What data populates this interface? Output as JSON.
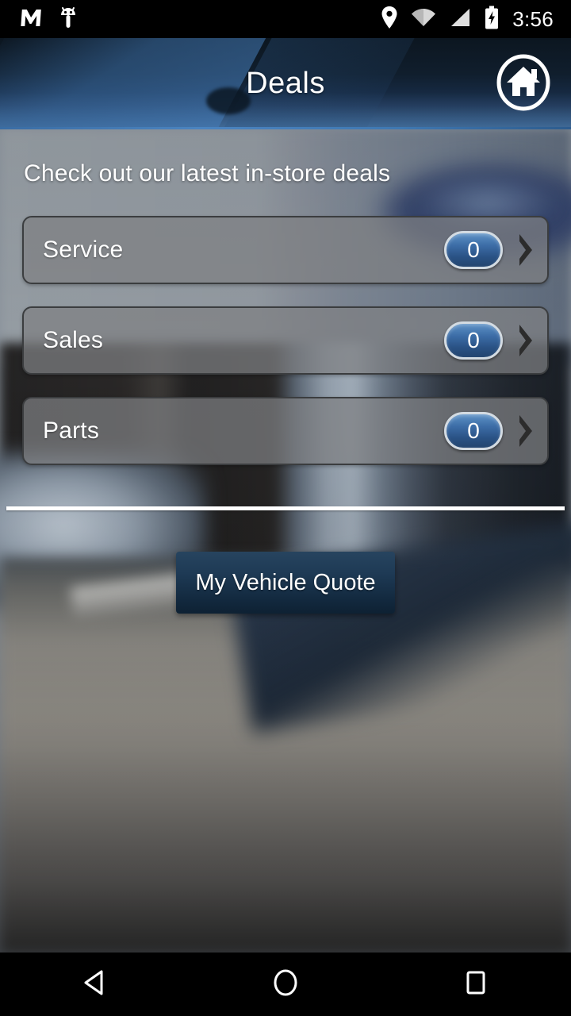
{
  "status_bar": {
    "icons": [
      "gmail-m-icon",
      "android-debug-icon",
      "location-pin-icon",
      "wifi-icon",
      "cellular-signal-icon",
      "battery-charging-icon"
    ],
    "time": "3:56"
  },
  "header": {
    "title": "Deals",
    "home_icon": "home-icon",
    "accent_color": "#3f78b2",
    "background_color": "#101e2d"
  },
  "main": {
    "subtitle": "Check out our latest in-store deals",
    "deals": [
      {
        "label": "Service",
        "count": "0",
        "chevron": "chevron-right-icon"
      },
      {
        "label": "Sales",
        "count": "0",
        "chevron": "chevron-right-icon"
      },
      {
        "label": "Parts",
        "count": "0",
        "chevron": "chevron-right-icon"
      }
    ],
    "badge_color": "#3d6ea8",
    "quote_button": {
      "label": "My Vehicle Quote",
      "color": "#1e3a55"
    }
  },
  "nav_bar": {
    "back": "back-triangle-icon",
    "home": "home-circle-icon",
    "recents": "recents-square-icon"
  }
}
